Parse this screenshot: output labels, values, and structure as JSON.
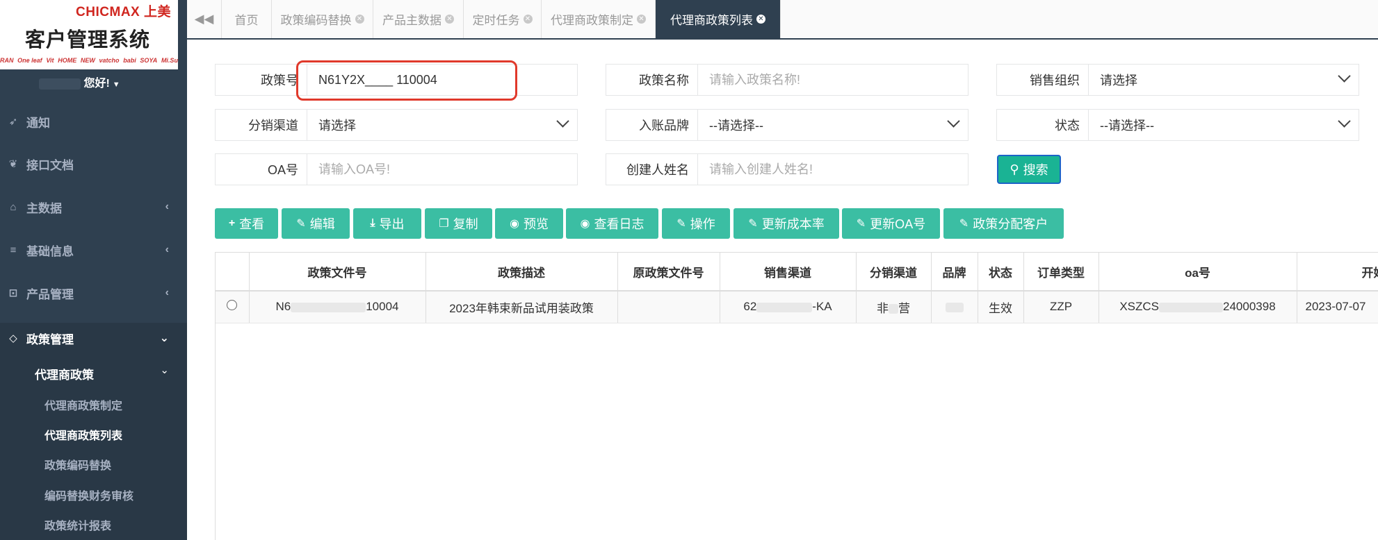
{
  "sidebar": {
    "brand": "CHICMAX 上美",
    "system_title": "客户管理系统",
    "logo_strip": [
      "RAN",
      "One leaf",
      "Vit",
      "HOME",
      "NEW",
      "vatcho",
      "babi",
      "SOYA",
      "Mi.Su"
    ],
    "greeting": "您好!",
    "menu": [
      {
        "label": "通知",
        "icon": "rocket-icon"
      },
      {
        "label": "接口文档",
        "icon": "leaf-icon"
      },
      {
        "label": "主数据",
        "icon": "home-icon",
        "has_children": true
      },
      {
        "label": "基础信息",
        "icon": "list-icon",
        "has_children": true
      },
      {
        "label": "产品管理",
        "icon": "box-icon",
        "has_children": true
      },
      {
        "label": "政策管理",
        "icon": "diamond-icon",
        "has_children": true,
        "expanded": true
      }
    ],
    "submenu_title": "代理商政策",
    "submenu": [
      {
        "label": "代理商政策制定",
        "active": false
      },
      {
        "label": "代理商政策列表",
        "active": true
      },
      {
        "label": "政策编码替换",
        "active": false
      },
      {
        "label": "编码替换财务审核",
        "active": false
      },
      {
        "label": "政策统计报表",
        "active": false
      }
    ]
  },
  "tabs": [
    {
      "label": "首页",
      "closable": false,
      "active": false
    },
    {
      "label": "政策编码替换",
      "closable": true,
      "active": false
    },
    {
      "label": "产品主数据",
      "closable": true,
      "active": false
    },
    {
      "label": "定时任务",
      "closable": true,
      "active": false
    },
    {
      "label": "代理商政策制定",
      "closable": true,
      "active": false
    },
    {
      "label": "代理商政策列表",
      "closable": true,
      "active": true
    }
  ],
  "form": {
    "policy_no": {
      "label": "政策号",
      "value": "N61Y2X____ 110004"
    },
    "policy_name": {
      "label": "政策名称",
      "placeholder": "请输入政策名称!"
    },
    "sales_org": {
      "label": "销售组织",
      "value": "请选择"
    },
    "dist_channel": {
      "label": "分销渠道",
      "value": "请选择"
    },
    "brand": {
      "label": "入账品牌",
      "value": "--请选择--"
    },
    "status": {
      "label": "状态",
      "value": "--请选择--"
    },
    "oa_no": {
      "label": "OA号",
      "placeholder": "请输入OA号!"
    },
    "creator": {
      "label": "创建人姓名",
      "placeholder": "请输入创建人姓名!"
    },
    "search_label": "搜索"
  },
  "toolbar": [
    {
      "label": "查看",
      "icon": "plus-icon"
    },
    {
      "label": "编辑",
      "icon": "pencil-icon"
    },
    {
      "label": "导出",
      "icon": "download-icon"
    },
    {
      "label": "复制",
      "icon": "copy-icon"
    },
    {
      "label": "预览",
      "icon": "eye-icon"
    },
    {
      "label": "查看日志",
      "icon": "eye-icon"
    },
    {
      "label": "操作",
      "icon": "pencil-icon"
    },
    {
      "label": "更新成本率",
      "icon": "pencil-icon"
    },
    {
      "label": "更新OA号",
      "icon": "pencil-icon"
    },
    {
      "label": "政策分配客户",
      "icon": "pencil-icon"
    }
  ],
  "table": {
    "columns": [
      "",
      "政策文件号",
      "政策描述",
      "原政策文件号",
      "销售渠道",
      "分销渠道",
      "品牌",
      "状态",
      "订单类型",
      "oa号",
      "开始时"
    ],
    "rows": [
      {
        "policy_file_no": [
          "N6",
          "10004"
        ],
        "description": "2023年韩束新品试用装政策",
        "orig_policy_file_no": "",
        "sales_channel": [
          "62",
          "-KA"
        ],
        "dist_channel": [
          "非",
          "营"
        ],
        "brand": "",
        "status": "生效",
        "order_type": "ZZP",
        "oa_no": [
          "XSZCS",
          "24000398"
        ],
        "start_date": "2023-07-07"
      }
    ]
  },
  "colors": {
    "sidebar_bg": "#2f4050",
    "accent": "#1ab394",
    "highlight": "#e0392b"
  }
}
